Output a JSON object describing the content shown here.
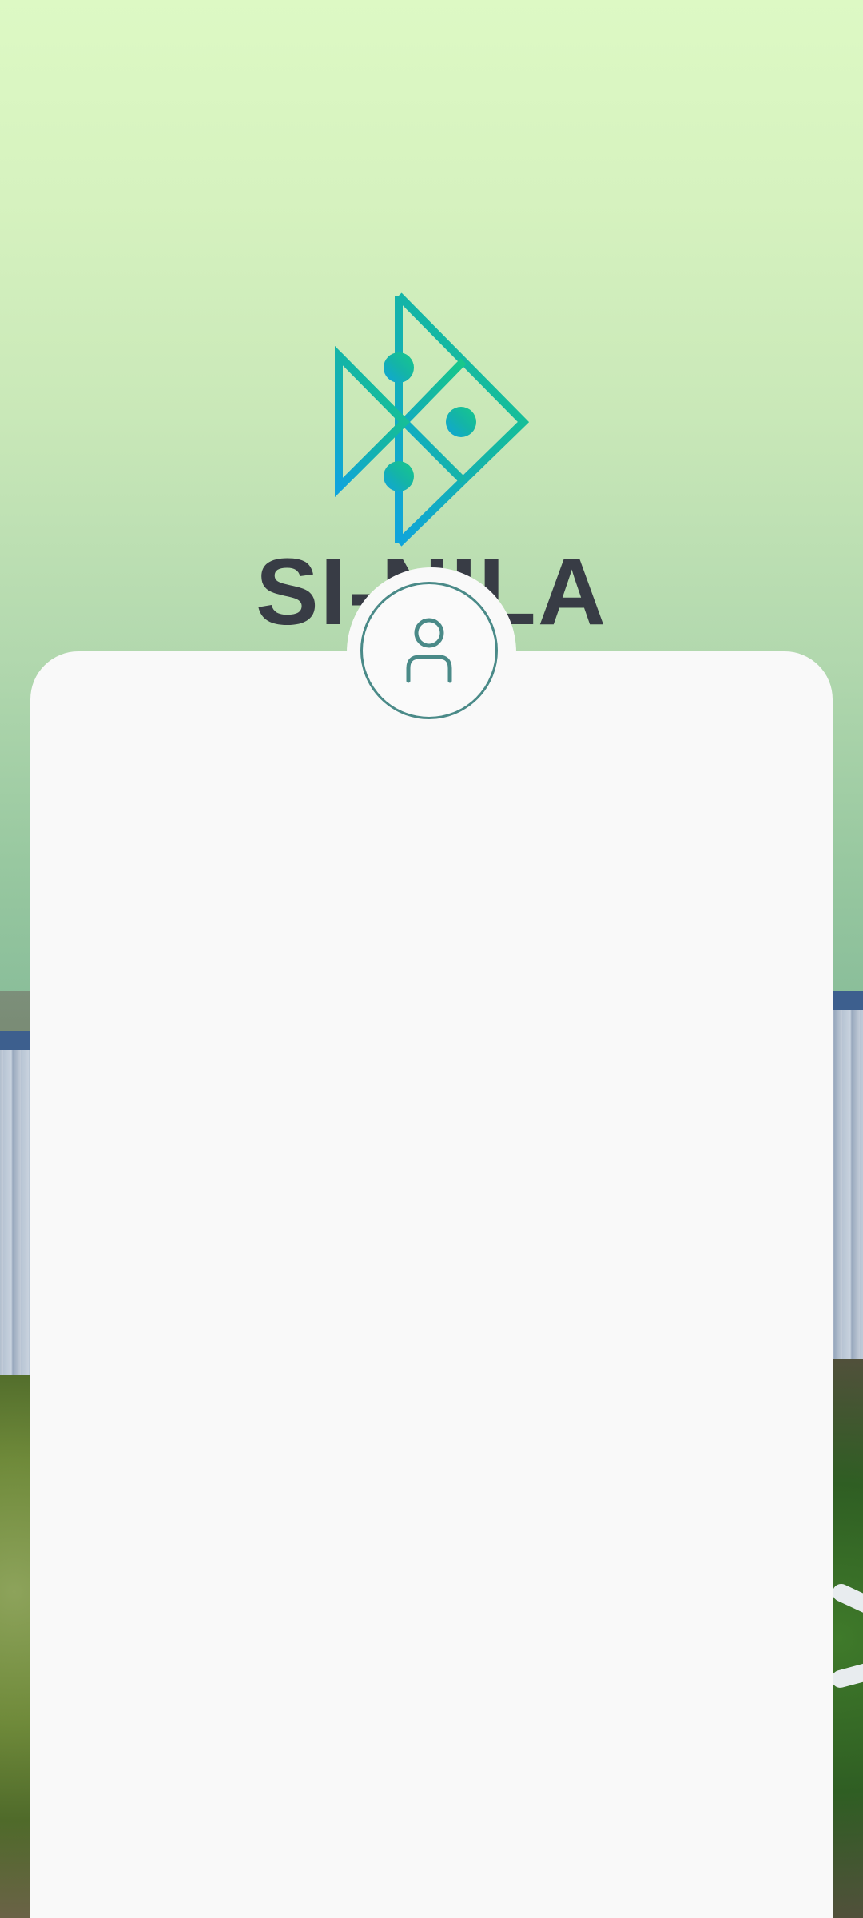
{
  "brand": {
    "name": "SI-NILA",
    "logo_icon": "fish-circuit-logo-icon"
  },
  "login_card": {
    "avatar_icon": "user-icon"
  },
  "colors": {
    "accent_green": "#17c08a",
    "accent_blue": "#12a7d8",
    "text_dark": "#383c45",
    "avatar_stroke": "#4a8a88",
    "card_bg": "#f9f9f9"
  }
}
